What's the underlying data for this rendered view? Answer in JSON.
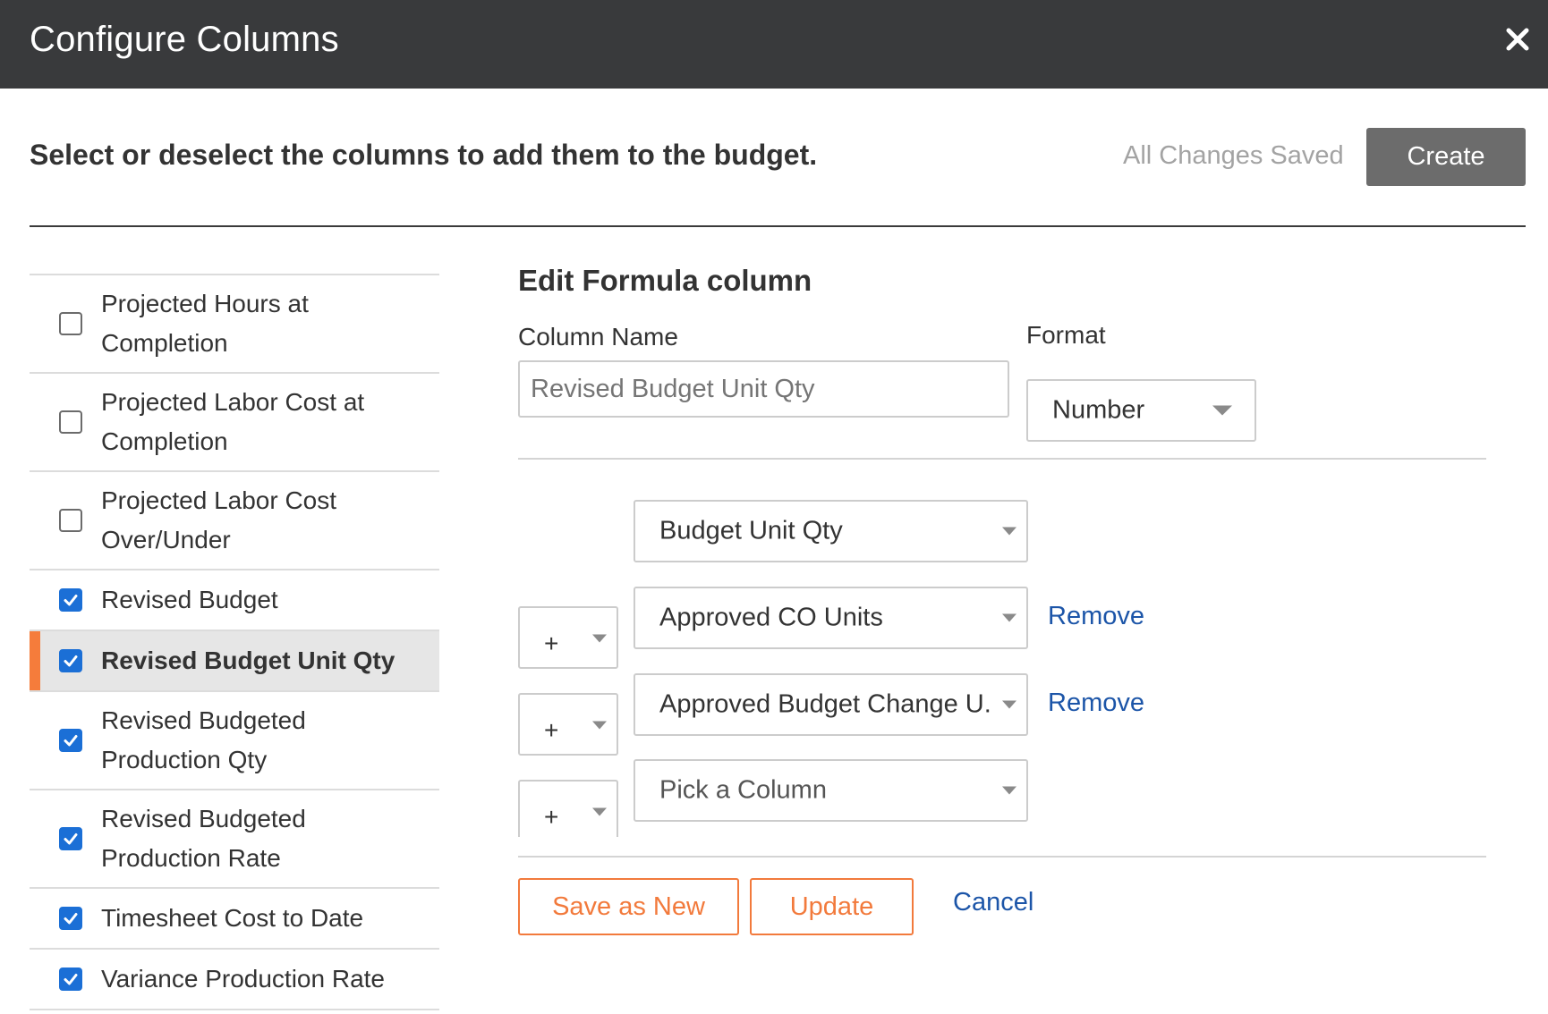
{
  "modal": {
    "title": "Configure Columns",
    "close_icon": "close-icon"
  },
  "toolbar": {
    "instruction": "Select or deselect the columns to add them to the budget.",
    "save_status": "All Changes Saved",
    "create_label": "Create"
  },
  "columns": [
    {
      "label": "Projected Hours at Completion",
      "checked": false,
      "selected": false
    },
    {
      "label": "Projected Labor Cost at Completion",
      "checked": false,
      "selected": false
    },
    {
      "label": "Projected Labor Cost Over/Under",
      "checked": false,
      "selected": false
    },
    {
      "label": "Revised Budget",
      "checked": true,
      "selected": false
    },
    {
      "label": "Revised Budget Unit Qty",
      "checked": true,
      "selected": true
    },
    {
      "label": "Revised Budgeted Production Qty",
      "checked": true,
      "selected": false
    },
    {
      "label": "Revised Budgeted Production Rate",
      "checked": true,
      "selected": false
    },
    {
      "label": "Timesheet Cost to Date",
      "checked": true,
      "selected": false
    },
    {
      "label": "Variance Production Rate",
      "checked": true,
      "selected": false
    }
  ],
  "editor": {
    "title": "Edit Formula column",
    "column_name_label": "Column Name",
    "column_name_value": "Revised Budget Unit Qty",
    "format_label": "Format",
    "format_value": "Number",
    "formula_rows": [
      {
        "operator": null,
        "column": "Budget Unit Qty",
        "removable": false
      },
      {
        "operator": "+",
        "column": "Approved CO Units",
        "removable": true
      },
      {
        "operator": "+",
        "column": "Approved Budget Change U...",
        "removable": true
      },
      {
        "operator": "+",
        "column": "Pick a Column",
        "removable": false
      }
    ],
    "remove_label": "Remove",
    "save_as_new_label": "Save as New",
    "update_label": "Update",
    "cancel_label": "Cancel"
  },
  "colors": {
    "header_bg": "#393a3c",
    "accent_orange": "#f27a3c",
    "checkbox_blue": "#1b6fd6",
    "link_blue": "#1c55a8"
  }
}
